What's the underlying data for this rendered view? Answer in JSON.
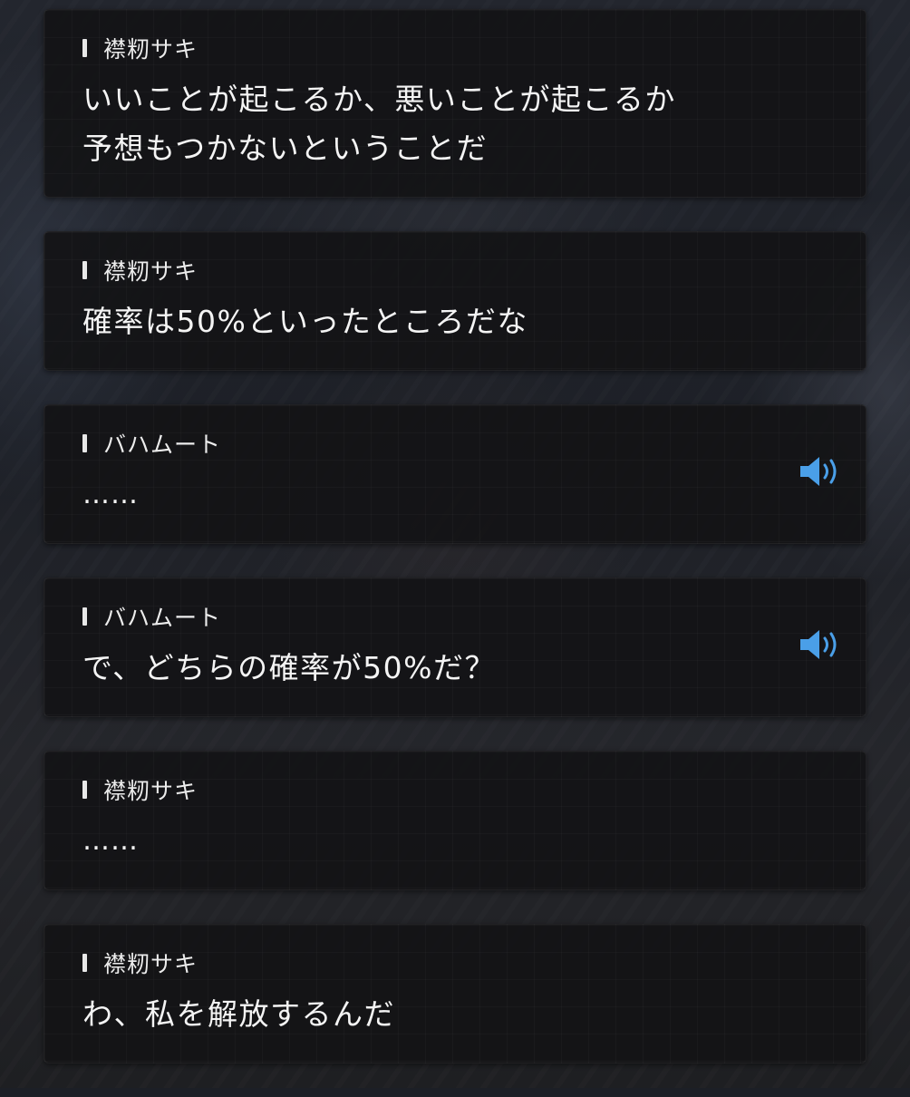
{
  "accent_color": "#4a9fe8",
  "entries": [
    {
      "speaker": "襟籾サキ",
      "lines": [
        "いいことが起こるか、悪いことが起こるか",
        "予想もつかないということだ"
      ],
      "voice": false
    },
    {
      "speaker": "襟籾サキ",
      "lines": [
        "確率は50%といったところだな"
      ],
      "voice": false
    },
    {
      "speaker": "バハムート",
      "lines": [
        "……"
      ],
      "voice": true,
      "voice_icon": "speaker-volume-icon"
    },
    {
      "speaker": "バハムート",
      "lines": [
        "で、どちらの確率が50%だ？"
      ],
      "voice": true,
      "voice_icon": "speaker-volume-icon"
    },
    {
      "speaker": "襟籾サキ",
      "lines": [
        "……"
      ],
      "voice": false
    },
    {
      "speaker": "襟籾サキ",
      "lines": [
        "わ、私を解放するんだ"
      ],
      "voice": false
    }
  ]
}
